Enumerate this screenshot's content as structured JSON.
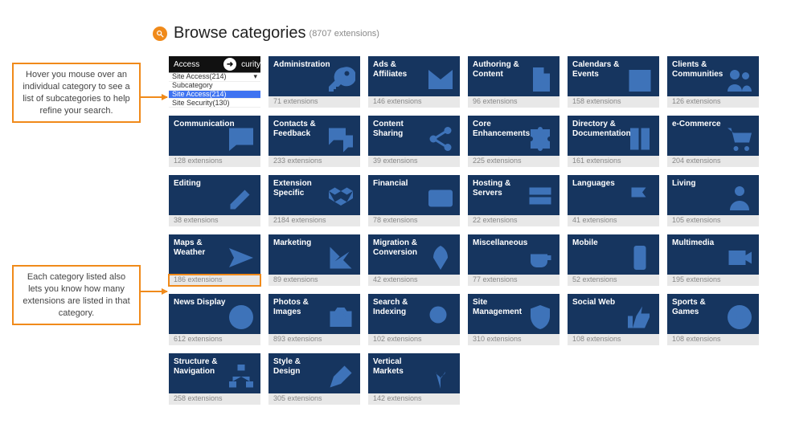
{
  "header": {
    "title": "Browse categories",
    "subtitle": "(8707 extensions)"
  },
  "callouts": {
    "hover": "Hover you mouse over an individual category to see a list of subcategories to help refine your search.",
    "count": "Each category listed also lets you know how many extensions are listed in that category."
  },
  "dropdown": {
    "title_left": "Access",
    "title_right": "curity",
    "selected": "Site Access(214)",
    "options": [
      "Subcategory",
      "Site Access(214)",
      "Site Security(130)"
    ]
  },
  "categories": [
    {
      "name": "Administration",
      "ext": "71 extensions",
      "icon": "key"
    },
    {
      "name": "Ads & Affiliates",
      "ext": "146 extensions",
      "icon": "envelope"
    },
    {
      "name": "Authoring & Content",
      "ext": "96 extensions",
      "icon": "doc"
    },
    {
      "name": "Calendars & Events",
      "ext": "158 extensions",
      "icon": "calendar"
    },
    {
      "name": "Clients & Communities",
      "ext": "126 extensions",
      "icon": "users"
    },
    {
      "name": "Communication",
      "ext": "128 extensions",
      "icon": "comment"
    },
    {
      "name": "Contacts & Feedback",
      "ext": "233 extensions",
      "icon": "comments"
    },
    {
      "name": "Content Sharing",
      "ext": "39 extensions",
      "icon": "share"
    },
    {
      "name": "Core Enhancements",
      "ext": "225 extensions",
      "icon": "puzzle"
    },
    {
      "name": "Directory & Documentation",
      "ext": "161 extensions",
      "icon": "book"
    },
    {
      "name": "e-Commerce",
      "ext": "204 extensions",
      "icon": "cart"
    },
    {
      "name": "Editing",
      "ext": "38 extensions",
      "icon": "edit"
    },
    {
      "name": "Extension Specific",
      "ext": "2184 extensions",
      "icon": "cubes"
    },
    {
      "name": "Financial",
      "ext": "78 extensions",
      "icon": "card"
    },
    {
      "name": "Hosting & Servers",
      "ext": "22 extensions",
      "icon": "server"
    },
    {
      "name": "Languages",
      "ext": "41 extensions",
      "icon": "flag"
    },
    {
      "name": "Living",
      "ext": "105 extensions",
      "icon": "person"
    },
    {
      "name": "Maps & Weather",
      "ext": "186 extensions",
      "icon": "plane",
      "highlight": true
    },
    {
      "name": "Marketing",
      "ext": "89 extensions",
      "icon": "chart"
    },
    {
      "name": "Migration & Conversion",
      "ext": "42 extensions",
      "icon": "rocket"
    },
    {
      "name": "Miscellaneous",
      "ext": "77 extensions",
      "icon": "coffee"
    },
    {
      "name": "Mobile",
      "ext": "52 extensions",
      "icon": "phone"
    },
    {
      "name": "Multimedia",
      "ext": "195 extensions",
      "icon": "video"
    },
    {
      "name": "News Display",
      "ext": "612 extensions",
      "icon": "alert"
    },
    {
      "name": "Photos & Images",
      "ext": "893 extensions",
      "icon": "camera"
    },
    {
      "name": "Search & Indexing",
      "ext": "102 extensions",
      "icon": "search"
    },
    {
      "name": "Site Management",
      "ext": "310 extensions",
      "icon": "shield"
    },
    {
      "name": "Social Web",
      "ext": "108 extensions",
      "icon": "thumb"
    },
    {
      "name": "Sports & Games",
      "ext": "108 extensions",
      "icon": "ball"
    },
    {
      "name": "Structure & Navigation",
      "ext": "258 extensions",
      "icon": "sitemap"
    },
    {
      "name": "Style & Design",
      "ext": "305 extensions",
      "icon": "brush"
    },
    {
      "name": "Vertical Markets",
      "ext": "142 extensions",
      "icon": "fork"
    }
  ]
}
